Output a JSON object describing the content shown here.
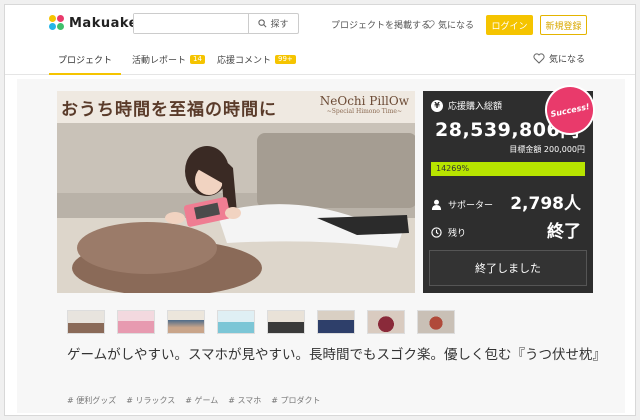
{
  "header": {
    "logo_text": "Makuake",
    "search_placeholder": "",
    "search_button": "探す",
    "post_project": "プロジェクトを掲載する",
    "favorites": "気になる",
    "login": "ログイン",
    "signup": "新規登録"
  },
  "tabs": {
    "project": "プロジェクト",
    "report": "活動レポート",
    "report_count": "14",
    "comments": "応援コメント",
    "comments_count": "99+",
    "favorite": "気になる"
  },
  "hero": {
    "title": "おうち時間を至福の時間に",
    "brand": "NeOchi PillOw",
    "brand_sub": "~Special Himono Time~"
  },
  "stats": {
    "amount_label": "応援購入総額",
    "amount": "28,539,806円",
    "goal": "目標金額 200,000円",
    "progress_text": "14269%",
    "progress_fraction": 1.0,
    "supporters_label": "サポーター",
    "supporters": "2,798人",
    "remaining_label": "残り",
    "remaining": "終了",
    "ended_button": "終了しました",
    "success_badge": "Success!"
  },
  "thumbnails": [
    "thumb-1",
    "thumb-2",
    "thumb-3",
    "thumb-4",
    "thumb-5",
    "thumb-6",
    "thumb-7",
    "thumb-8"
  ],
  "headline": "ゲームがしやすい。スマホが見やすい。長時間でもスゴク楽。優しく包む『うつ伏せ枕』",
  "tags": [
    "# 便利グッズ",
    "# リラックス",
    "# ゲーム",
    "# スマホ",
    "# プロダクト"
  ],
  "colors": {
    "brand_yellow": "#f5c400",
    "progress_green": "#b7e400",
    "success_pink": "#e93a6b",
    "panel_dark": "#2e2e2e"
  }
}
